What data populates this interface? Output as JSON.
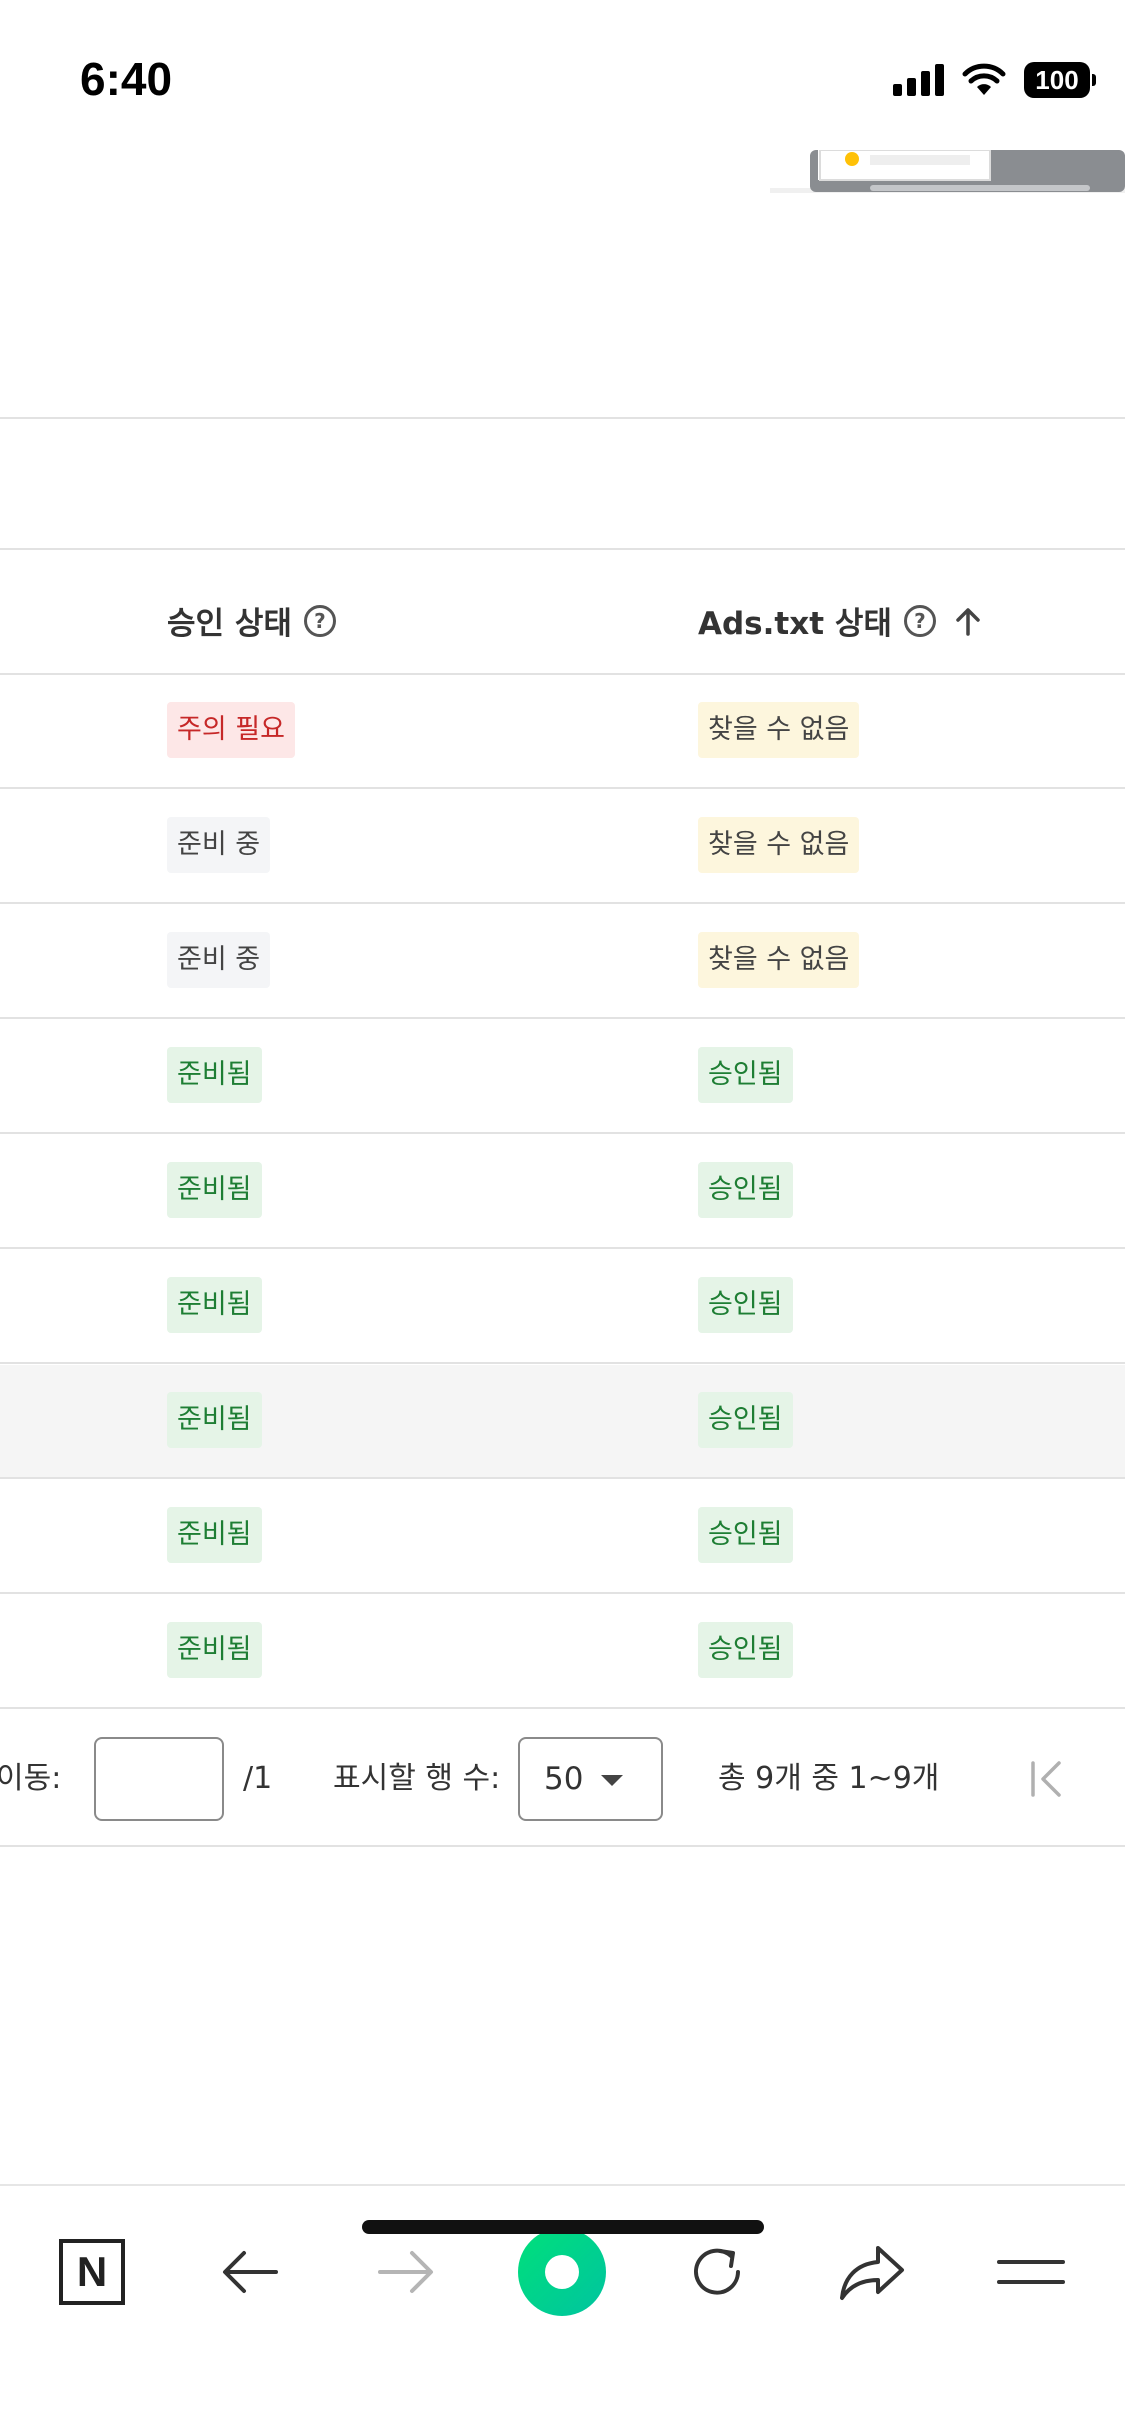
{
  "status_bar": {
    "time": "6:40",
    "battery": "100"
  },
  "table": {
    "headers": [
      {
        "label": "승인 상태"
      },
      {
        "label": "Ads.txt 상태"
      }
    ],
    "rows": [
      {
        "approval": "주의 필요",
        "approval_tone": "red",
        "adstxt": "찾을 수 없음",
        "adstxt_tone": "yellow"
      },
      {
        "approval": "준비 중",
        "approval_tone": "gray",
        "adstxt": "찾을 수 없음",
        "adstxt_tone": "yellow"
      },
      {
        "approval": "준비 중",
        "approval_tone": "gray",
        "adstxt": "찾을 수 없음",
        "adstxt_tone": "yellow"
      },
      {
        "approval": "준비됨",
        "approval_tone": "green",
        "adstxt": "승인됨",
        "adstxt_tone": "green"
      },
      {
        "approval": "준비됨",
        "approval_tone": "green",
        "adstxt": "승인됨",
        "adstxt_tone": "green"
      },
      {
        "approval": "준비됨",
        "approval_tone": "green",
        "adstxt": "승인됨",
        "adstxt_tone": "green"
      },
      {
        "approval": "준비됨",
        "approval_tone": "green",
        "adstxt": "승인됨",
        "adstxt_tone": "green"
      },
      {
        "approval": "준비됨",
        "approval_tone": "green",
        "adstxt": "승인됨",
        "adstxt_tone": "green"
      },
      {
        "approval": "준비됨",
        "approval_tone": "green",
        "adstxt": "승인됨",
        "adstxt_tone": "green"
      }
    ]
  },
  "pagination": {
    "goto_label": "이동:",
    "page_value": "",
    "total_pages": "/1",
    "rows_label": "표시할 행 수:",
    "rows_value": "50",
    "range_text": "총 9개 중 1~9개"
  },
  "colors": {
    "red": "#c62828",
    "green": "#1e7e34",
    "brand_green": "#00de7a"
  }
}
